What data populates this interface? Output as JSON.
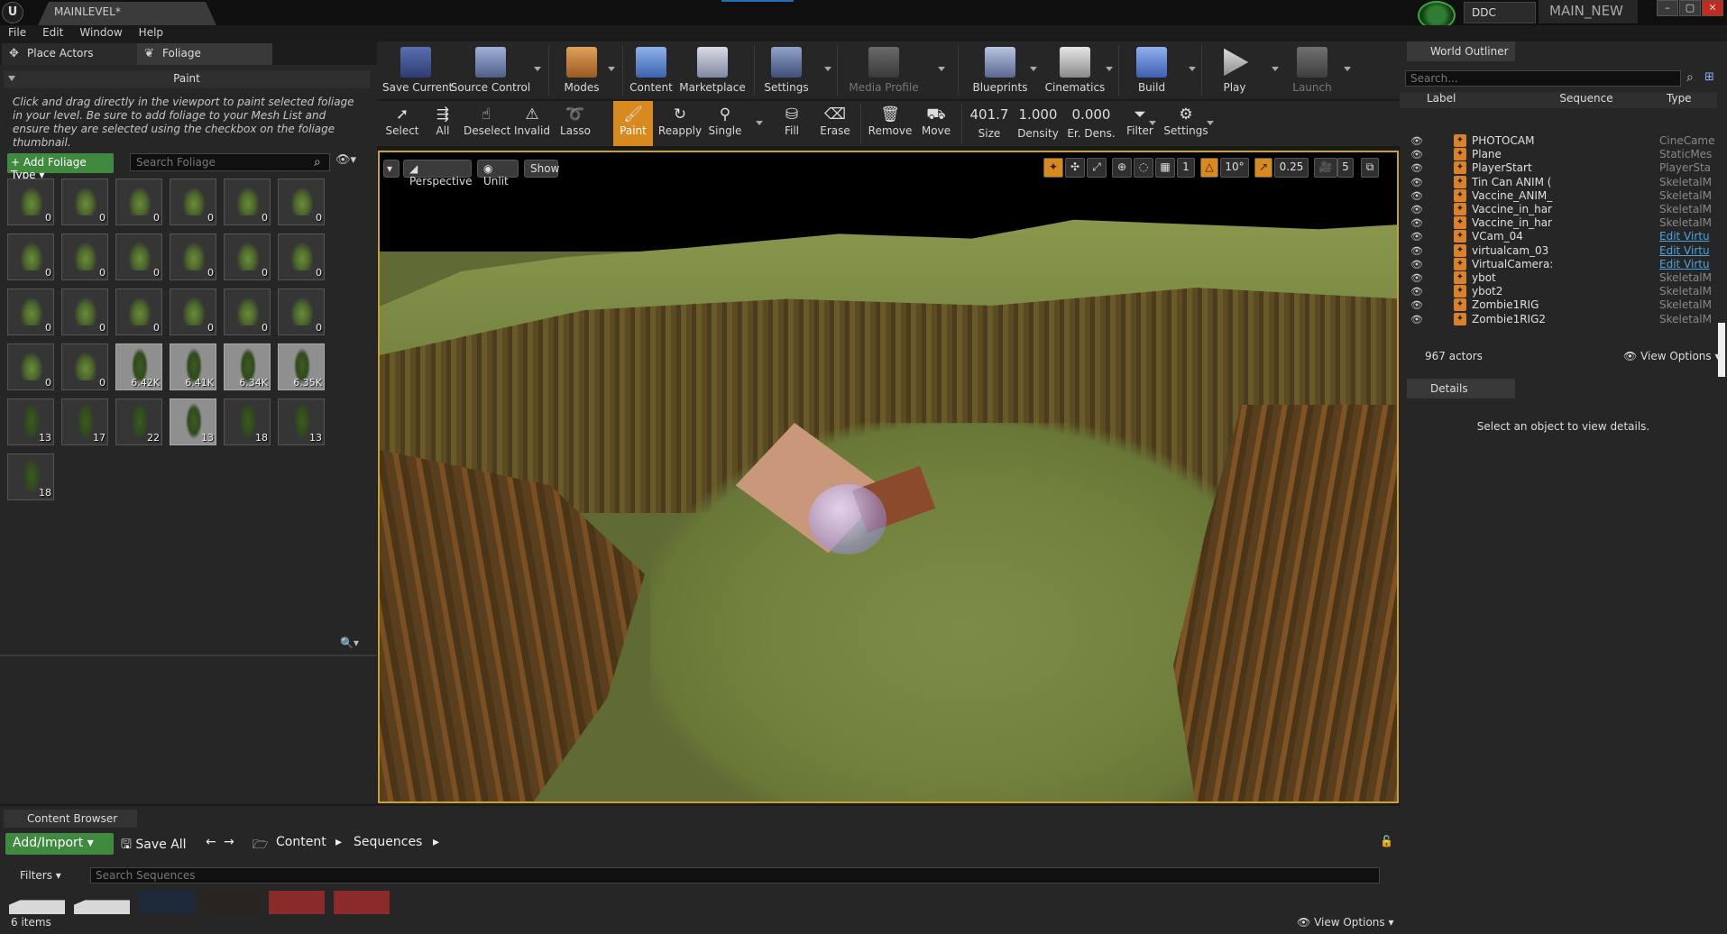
{
  "titlebar": {
    "level_tab": "MAINLEVEL*",
    "ddc": "DDC",
    "project": "MAIN_NEW",
    "minimize": "–",
    "maximize": "▢",
    "close": "✕"
  },
  "menu": [
    "File",
    "Edit",
    "Window",
    "Help"
  ],
  "left_tabs": {
    "place_actors": "Place Actors",
    "foliage": "Foliage"
  },
  "paint": {
    "header": "Paint",
    "help": "Click and drag directly in the viewport to paint selected foliage in your level. Be sure to add foliage to your Mesh List and ensure they are selected using the checkbox on the foliage thumbnail.",
    "add_button": "+ Add Foliage Type ▾",
    "search_placeholder": "Search Foliage"
  },
  "foliage_tiles": [
    {
      "count": "0",
      "kind": "plant",
      "active": false
    },
    {
      "count": "0",
      "kind": "plant",
      "active": false
    },
    {
      "count": "0",
      "kind": "plant",
      "active": false
    },
    {
      "count": "0",
      "kind": "plant",
      "active": false
    },
    {
      "count": "0",
      "kind": "plant",
      "active": false
    },
    {
      "count": "0",
      "kind": "plant",
      "active": false
    },
    {
      "count": "0",
      "kind": "plant",
      "active": false
    },
    {
      "count": "0",
      "kind": "plant",
      "active": false
    },
    {
      "count": "0",
      "kind": "plant",
      "active": false
    },
    {
      "count": "0",
      "kind": "plant",
      "active": false
    },
    {
      "count": "0",
      "kind": "plant",
      "active": false
    },
    {
      "count": "0",
      "kind": "plant",
      "active": false
    },
    {
      "count": "0",
      "kind": "plant",
      "active": false
    },
    {
      "count": "0",
      "kind": "plant",
      "active": false
    },
    {
      "count": "0",
      "kind": "plant",
      "active": false
    },
    {
      "count": "0",
      "kind": "plant",
      "active": false
    },
    {
      "count": "0",
      "kind": "plant",
      "active": false
    },
    {
      "count": "0",
      "kind": "plant",
      "active": false
    },
    {
      "count": "0",
      "kind": "plant",
      "active": false
    },
    {
      "count": "0",
      "kind": "plant",
      "active": false
    },
    {
      "count": "6.42K",
      "kind": "tree",
      "active": true
    },
    {
      "count": "6.41K",
      "kind": "tree",
      "active": true
    },
    {
      "count": "6.34K",
      "kind": "tree",
      "active": true
    },
    {
      "count": "6.35K",
      "kind": "tree",
      "active": true
    },
    {
      "count": "13",
      "kind": "tree",
      "active": false
    },
    {
      "count": "17",
      "kind": "tree",
      "active": false
    },
    {
      "count": "22",
      "kind": "tree",
      "active": false
    },
    {
      "count": "13",
      "kind": "tree",
      "active": true
    },
    {
      "count": "18",
      "kind": "tree",
      "active": false
    },
    {
      "count": "13",
      "kind": "tree",
      "active": false
    },
    {
      "count": "18",
      "kind": "tree",
      "active": false
    }
  ],
  "toolbar": {
    "save_current": "Save Current",
    "source_control": "Source Control",
    "modes": "Modes",
    "content": "Content",
    "marketplace": "Marketplace",
    "settings": "Settings",
    "media_profile": "Media Profile",
    "blueprints": "Blueprints",
    "cinematics": "Cinematics",
    "build": "Build",
    "play": "Play",
    "launch": "Launch"
  },
  "mode_toolbar": {
    "select": "Select",
    "all": "All",
    "deselect": "Deselect",
    "invalid": "Invalid",
    "lasso": "Lasso",
    "paint": "Paint",
    "reapply": "Reapply",
    "single": "Single",
    "fill": "Fill",
    "erase": "Erase",
    "remove": "Remove",
    "move": "Move",
    "size_value": "401.7",
    "size_label": "Size",
    "density_value": "1.000",
    "density_label": "Density",
    "erdens_value": "0.000",
    "erdens_label": "Er. Dens.",
    "filter": "Filter",
    "settings": "Settings"
  },
  "viewport": {
    "perspective": "Perspective",
    "unlit": "Unlit",
    "show": "Show",
    "grid_snap": "1",
    "rot_snap": "10°",
    "scale_snap": "0.25",
    "cam_speed": "5"
  },
  "outliner": {
    "tab": "World Outliner",
    "search_placeholder": "Search...",
    "col_label": "Label",
    "col_sequence": "Sequence",
    "col_type": "Type",
    "rows": [
      {
        "label": "PHOTOCAM",
        "type": "CineCame",
        "link": false
      },
      {
        "label": "Plane",
        "type": "StaticMes",
        "link": false
      },
      {
        "label": "PlayerStart",
        "type": "PlayerSta",
        "link": false
      },
      {
        "label": "Tin Can ANIM (",
        "type": "SkeletalM",
        "link": false
      },
      {
        "label": "Vaccine_ANIM_",
        "type": "SkeletalM",
        "link": false
      },
      {
        "label": "Vaccine_in_har",
        "type": "SkeletalM",
        "link": false
      },
      {
        "label": "Vaccine_in_har",
        "type": "SkeletalM",
        "link": false
      },
      {
        "label": "VCam_04",
        "type": "Edit Virtu",
        "link": true
      },
      {
        "label": "virtualcam_03",
        "type": "Edit Virtu",
        "link": true
      },
      {
        "label": "VirtualCamera:",
        "type": "Edit Virtu",
        "link": true
      },
      {
        "label": "ybot",
        "type": "SkeletalM",
        "link": false
      },
      {
        "label": "ybot2",
        "type": "SkeletalM",
        "link": false
      },
      {
        "label": "Zombie1RIG",
        "type": "SkeletalM",
        "link": false
      },
      {
        "label": "Zombie1RIG2",
        "type": "SkeletalM",
        "link": false
      }
    ],
    "count": "967 actors",
    "view_options": "View Options ▾"
  },
  "details": {
    "tab": "Details",
    "message": "Select an object to view details."
  },
  "content_browser": {
    "tab": "Content Browser",
    "add_import": "Add/Import ▾",
    "save_all": "Save All",
    "crumb_content": "Content",
    "crumb_sequences": "Sequences",
    "filters": "Filters ▾",
    "search_placeholder": "Search Sequences",
    "items": "6 items",
    "view_options": "View Options ▾"
  }
}
